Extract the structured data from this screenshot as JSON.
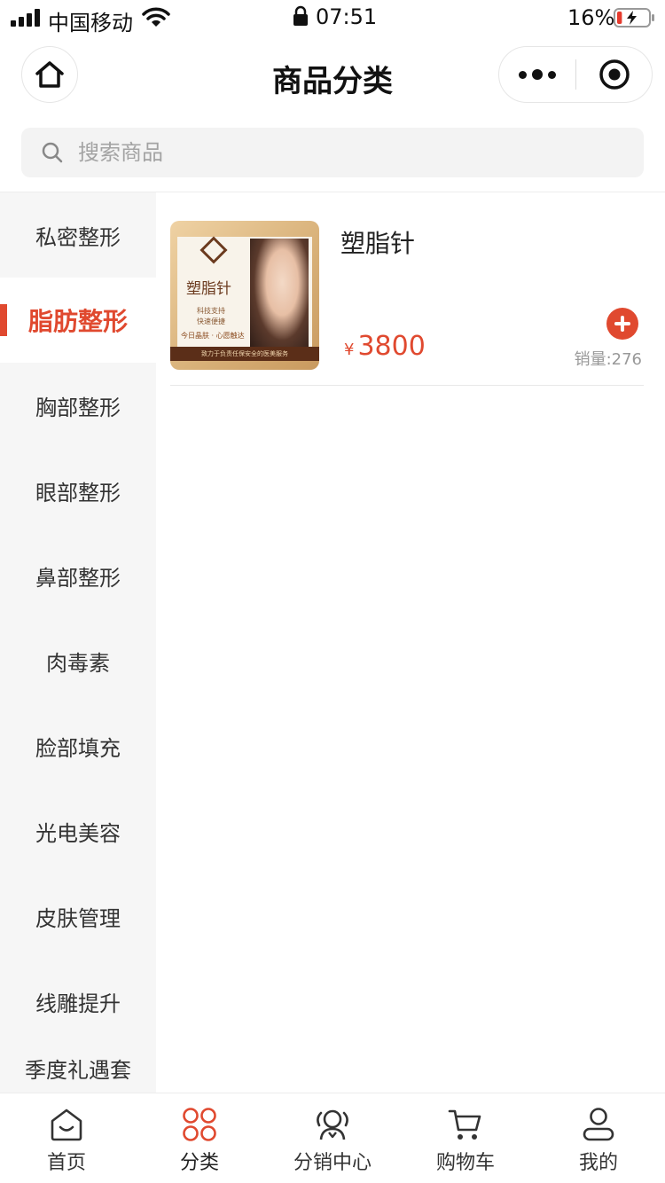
{
  "status_bar": {
    "carrier": "中国移动",
    "time": "07:51",
    "battery_percent": "16%",
    "battery_level": 0.16
  },
  "nav": {
    "title": "商品分类",
    "home_icon": "home-icon",
    "more_icon": "more-dots-icon",
    "close_icon": "target-circle-icon"
  },
  "search": {
    "placeholder": "搜索商品",
    "icon": "search-icon"
  },
  "categories": [
    {
      "label": "私密整形",
      "active": false
    },
    {
      "label": "脂肪整形",
      "active": true
    },
    {
      "label": "胸部整形",
      "active": false
    },
    {
      "label": "眼部整形",
      "active": false
    },
    {
      "label": "鼻部整形",
      "active": false
    },
    {
      "label": "肉毒素",
      "active": false
    },
    {
      "label": "脸部填充",
      "active": false
    },
    {
      "label": "光电美容",
      "active": false
    },
    {
      "label": "皮肤管理",
      "active": false
    },
    {
      "label": "线雕提升",
      "active": false
    },
    {
      "label": "季度礼遇套",
      "active": false
    }
  ],
  "products": [
    {
      "name": "塑脂针",
      "currency": "¥",
      "price": "3800",
      "sales": "销量:276",
      "image": {
        "title": "塑脂针",
        "line1": "科技支持",
        "line2": "快速便捷",
        "slogan": "今日晶肤 · 心愿触达",
        "band": "致力于负责任保安全的医美服务"
      }
    }
  ],
  "tabbar": [
    {
      "label": "首页",
      "icon": "home-outline-icon",
      "active": false
    },
    {
      "label": "分类",
      "icon": "category-grid-icon",
      "active": true
    },
    {
      "label": "分销中心",
      "icon": "distribution-user-icon",
      "active": false
    },
    {
      "label": "购物车",
      "icon": "cart-icon",
      "active": false
    },
    {
      "label": "我的",
      "icon": "profile-icon",
      "active": false
    }
  ],
  "colors": {
    "accent": "#e0492f",
    "sidebar_bg": "#f6f6f6",
    "text": "#222222",
    "muted": "#999999"
  }
}
